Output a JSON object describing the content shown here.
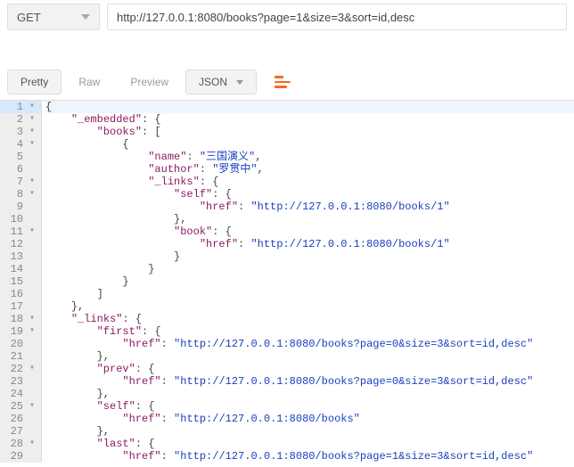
{
  "request": {
    "method": "GET",
    "url": "http://127.0.0.1:8080/books?page=1&size=3&sort=id,desc"
  },
  "response": {
    "tabs": {
      "pretty": "Pretty",
      "raw": "Raw",
      "preview": "Preview"
    },
    "format": "JSON"
  },
  "json_lines": [
    {
      "n": 1,
      "fold": "▾",
      "hl": true,
      "segs": [
        {
          "c": "p",
          "t": "{"
        }
      ]
    },
    {
      "n": 2,
      "fold": "▾",
      "segs": [
        {
          "c": "p",
          "t": "    "
        },
        {
          "c": "k",
          "t": "\"_embedded\""
        },
        {
          "c": "p",
          "t": ": {"
        }
      ]
    },
    {
      "n": 3,
      "fold": "▾",
      "segs": [
        {
          "c": "p",
          "t": "        "
        },
        {
          "c": "k",
          "t": "\"books\""
        },
        {
          "c": "p",
          "t": ": ["
        }
      ]
    },
    {
      "n": 4,
      "fold": "▾",
      "segs": [
        {
          "c": "p",
          "t": "            {"
        }
      ]
    },
    {
      "n": 5,
      "fold": "",
      "segs": [
        {
          "c": "p",
          "t": "                "
        },
        {
          "c": "k",
          "t": "\"name\""
        },
        {
          "c": "p",
          "t": ": "
        },
        {
          "c": "s",
          "t": "\"三国演义\""
        },
        {
          "c": "p",
          "t": ","
        }
      ]
    },
    {
      "n": 6,
      "fold": "",
      "segs": [
        {
          "c": "p",
          "t": "                "
        },
        {
          "c": "k",
          "t": "\"author\""
        },
        {
          "c": "p",
          "t": ": "
        },
        {
          "c": "s",
          "t": "\"罗贯中\""
        },
        {
          "c": "p",
          "t": ","
        }
      ]
    },
    {
      "n": 7,
      "fold": "▾",
      "segs": [
        {
          "c": "p",
          "t": "                "
        },
        {
          "c": "k",
          "t": "\"_links\""
        },
        {
          "c": "p",
          "t": ": {"
        }
      ]
    },
    {
      "n": 8,
      "fold": "▾",
      "segs": [
        {
          "c": "p",
          "t": "                    "
        },
        {
          "c": "k",
          "t": "\"self\""
        },
        {
          "c": "p",
          "t": ": {"
        }
      ]
    },
    {
      "n": 9,
      "fold": "",
      "segs": [
        {
          "c": "p",
          "t": "                        "
        },
        {
          "c": "k",
          "t": "\"href\""
        },
        {
          "c": "p",
          "t": ": "
        },
        {
          "c": "s",
          "t": "\"http://127.0.0.1:8080/books/1\""
        }
      ]
    },
    {
      "n": 10,
      "fold": "",
      "segs": [
        {
          "c": "p",
          "t": "                    },"
        }
      ]
    },
    {
      "n": 11,
      "fold": "▾",
      "segs": [
        {
          "c": "p",
          "t": "                    "
        },
        {
          "c": "k",
          "t": "\"book\""
        },
        {
          "c": "p",
          "t": ": {"
        }
      ]
    },
    {
      "n": 12,
      "fold": "",
      "segs": [
        {
          "c": "p",
          "t": "                        "
        },
        {
          "c": "k",
          "t": "\"href\""
        },
        {
          "c": "p",
          "t": ": "
        },
        {
          "c": "s",
          "t": "\"http://127.0.0.1:8080/books/1\""
        }
      ]
    },
    {
      "n": 13,
      "fold": "",
      "segs": [
        {
          "c": "p",
          "t": "                    }"
        }
      ]
    },
    {
      "n": 14,
      "fold": "",
      "segs": [
        {
          "c": "p",
          "t": "                }"
        }
      ]
    },
    {
      "n": 15,
      "fold": "",
      "segs": [
        {
          "c": "p",
          "t": "            }"
        }
      ]
    },
    {
      "n": 16,
      "fold": "",
      "segs": [
        {
          "c": "p",
          "t": "        ]"
        }
      ]
    },
    {
      "n": 17,
      "fold": "",
      "segs": [
        {
          "c": "p",
          "t": "    },"
        }
      ]
    },
    {
      "n": 18,
      "fold": "▾",
      "segs": [
        {
          "c": "p",
          "t": "    "
        },
        {
          "c": "k",
          "t": "\"_links\""
        },
        {
          "c": "p",
          "t": ": {"
        }
      ]
    },
    {
      "n": 19,
      "fold": "▾",
      "segs": [
        {
          "c": "p",
          "t": "        "
        },
        {
          "c": "k",
          "t": "\"first\""
        },
        {
          "c": "p",
          "t": ": {"
        }
      ]
    },
    {
      "n": 20,
      "fold": "",
      "segs": [
        {
          "c": "p",
          "t": "            "
        },
        {
          "c": "k",
          "t": "\"href\""
        },
        {
          "c": "p",
          "t": ": "
        },
        {
          "c": "s",
          "t": "\"http://127.0.0.1:8080/books?page=0&size=3&sort=id,desc\""
        }
      ]
    },
    {
      "n": 21,
      "fold": "",
      "segs": [
        {
          "c": "p",
          "t": "        },"
        }
      ]
    },
    {
      "n": 22,
      "fold": "▾",
      "segs": [
        {
          "c": "p",
          "t": "        "
        },
        {
          "c": "k",
          "t": "\"prev\""
        },
        {
          "c": "p",
          "t": ": {"
        }
      ]
    },
    {
      "n": 23,
      "fold": "",
      "segs": [
        {
          "c": "p",
          "t": "            "
        },
        {
          "c": "k",
          "t": "\"href\""
        },
        {
          "c": "p",
          "t": ": "
        },
        {
          "c": "s",
          "t": "\"http://127.0.0.1:8080/books?page=0&size=3&sort=id,desc\""
        }
      ]
    },
    {
      "n": 24,
      "fold": "",
      "segs": [
        {
          "c": "p",
          "t": "        },"
        }
      ]
    },
    {
      "n": 25,
      "fold": "▾",
      "segs": [
        {
          "c": "p",
          "t": "        "
        },
        {
          "c": "k",
          "t": "\"self\""
        },
        {
          "c": "p",
          "t": ": {"
        }
      ]
    },
    {
      "n": 26,
      "fold": "",
      "segs": [
        {
          "c": "p",
          "t": "            "
        },
        {
          "c": "k",
          "t": "\"href\""
        },
        {
          "c": "p",
          "t": ": "
        },
        {
          "c": "s",
          "t": "\"http://127.0.0.1:8080/books\""
        }
      ]
    },
    {
      "n": 27,
      "fold": "",
      "segs": [
        {
          "c": "p",
          "t": "        },"
        }
      ]
    },
    {
      "n": 28,
      "fold": "▾",
      "segs": [
        {
          "c": "p",
          "t": "        "
        },
        {
          "c": "k",
          "t": "\"last\""
        },
        {
          "c": "p",
          "t": ": {"
        }
      ]
    },
    {
      "n": 29,
      "fold": "",
      "segs": [
        {
          "c": "p",
          "t": "            "
        },
        {
          "c": "k",
          "t": "\"href\""
        },
        {
          "c": "p",
          "t": ": "
        },
        {
          "c": "s",
          "t": "\"http://127.0.0.1:8080/books?page=1&size=3&sort=id,desc\""
        }
      ]
    }
  ]
}
